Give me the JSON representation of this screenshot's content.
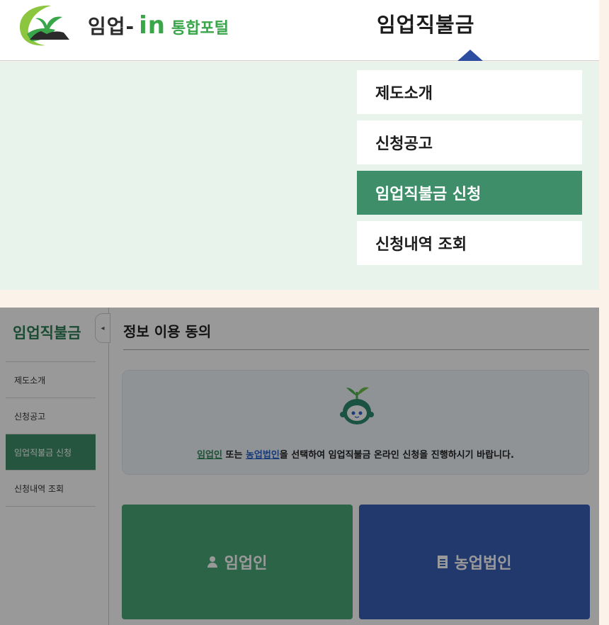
{
  "header": {
    "brand_main": "임업",
    "brand_dash": " - ",
    "brand_in": "in",
    "brand_sub": "통합포털",
    "top_menu": "임업직불금"
  },
  "dropdown": {
    "items": [
      {
        "label": "제도소개",
        "active": false
      },
      {
        "label": "신청공고",
        "active": false
      },
      {
        "label": "임업직불금 신청",
        "active": true
      },
      {
        "label": "신청내역 조회",
        "active": false
      }
    ]
  },
  "sidebar": {
    "title": "임업직불금",
    "toggle_glyph": "◂",
    "items": [
      {
        "label": "제도소개",
        "active": false
      },
      {
        "label": "신청공고",
        "active": false
      },
      {
        "label": "임업직불금 신청",
        "active": true
      },
      {
        "label": "신청내역 조회",
        "active": false
      }
    ]
  },
  "main": {
    "title": "정보 이용 동의",
    "info": {
      "option1": "임업인",
      "connector": " 또는 ",
      "option2": "농업법인",
      "rest": "을 선택하여 임업직불금 온라인 신청을 진행하시기 바랍니다."
    },
    "choices": {
      "person_label": "임업인",
      "corp_label": "농업법인"
    }
  },
  "colors": {
    "primary_green": "#3e8e6a",
    "brand_green": "#3aa64a",
    "corp_blue": "#3a5fb8",
    "caret_blue": "#2d4ea0"
  },
  "icons": [
    "logo-sprout-icon",
    "mascot-icon",
    "person-icon",
    "building-icon",
    "chevron-left-icon"
  ]
}
